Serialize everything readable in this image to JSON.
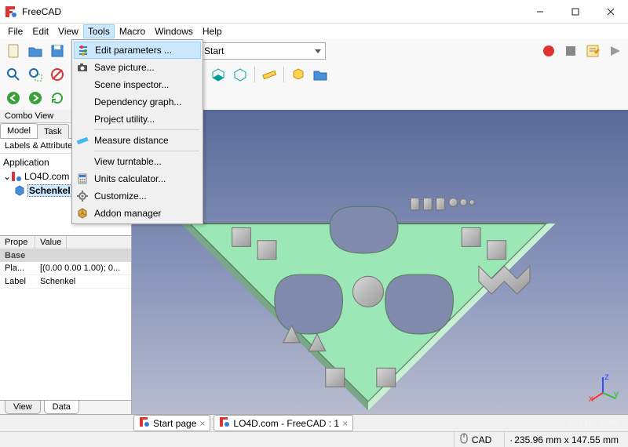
{
  "window": {
    "title": "FreeCAD"
  },
  "menubar": {
    "items": [
      "File",
      "Edit",
      "View",
      "Tools",
      "Macro",
      "Windows",
      "Help"
    ],
    "open_index": 3
  },
  "tools_menu": {
    "items": [
      {
        "label": "Edit parameters ...",
        "icon": "sliders"
      },
      {
        "label": "Save picture...",
        "icon": "camera"
      },
      {
        "label": "Scene inspector...",
        "icon": ""
      },
      {
        "label": "Dependency graph...",
        "icon": ""
      },
      {
        "label": "Project utility...",
        "icon": ""
      }
    ],
    "items2": [
      {
        "label": "Measure distance",
        "icon": "ruler-blue"
      }
    ],
    "items3": [
      {
        "label": "View turntable...",
        "icon": ""
      },
      {
        "label": "Units calculator...",
        "icon": "calculator"
      },
      {
        "label": "Customize...",
        "icon": "gear"
      },
      {
        "label": "Addon manager",
        "icon": "package"
      }
    ],
    "highlighted": "Edit parameters ..."
  },
  "toolbar1": {
    "workbench_combo": "Start"
  },
  "combo_view": {
    "title": "Combo View",
    "tabs": [
      "Model",
      "Task"
    ],
    "section": "Labels & Attributes",
    "tree": {
      "root": "Application",
      "doc": "LO4D.com",
      "item": "Schenkel"
    },
    "prop_headers": [
      "Prope",
      "Value"
    ],
    "prop_group": "Base",
    "props": [
      {
        "name": "Pla...",
        "value": "[(0.00 0.00 1.00); 0..."
      },
      {
        "name": "Label",
        "value": "Schenkel"
      }
    ],
    "bottom_tabs": [
      "View",
      "Data"
    ]
  },
  "doc_tabs": {
    "tabs": [
      {
        "label": "Start page"
      },
      {
        "label": "LO4D.com - FreeCAD : 1"
      }
    ]
  },
  "status": {
    "nav": "CAD",
    "dims": "235.96 mm x 147.55 mm"
  },
  "watermark": "LO4D.com"
}
